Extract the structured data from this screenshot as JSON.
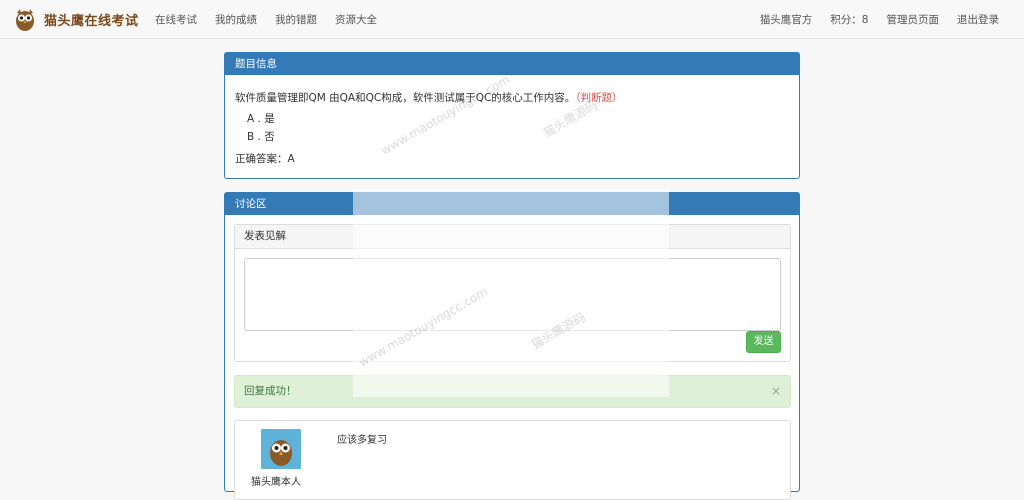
{
  "navbar": {
    "brand": "猫头鹰在线考试",
    "left_links": [
      "在线考试",
      "我的成绩",
      "我的错题",
      "资源大全"
    ],
    "right_links": [
      "猫头鹰官方",
      "积分：8",
      "管理员页面",
      "退出登录"
    ]
  },
  "question": {
    "heading": "题目信息",
    "stem": "软件质量管理即QM 由QA和QC构成，软件测试属于QC的核心工作内容。",
    "type": "（判断题）",
    "options": [
      "A . 是",
      "B . 否"
    ],
    "answer": "正确答案：A"
  },
  "discussion": {
    "heading": "讨论区",
    "post_heading": "发表见解",
    "send_label": "发送",
    "alert_text": "回复成功！",
    "alert_close": "×",
    "reply": {
      "content": "应该多复习",
      "name": "猫头鹰本人"
    }
  },
  "watermark": {
    "text_url": "www.maotouyingcc.com",
    "text_cn": "猫头鹰源码"
  },
  "colors": {
    "primary": "#337ab7",
    "success": "#5cb85c",
    "alert_bg": "#dff0d8",
    "danger_text": "#d9534f"
  }
}
